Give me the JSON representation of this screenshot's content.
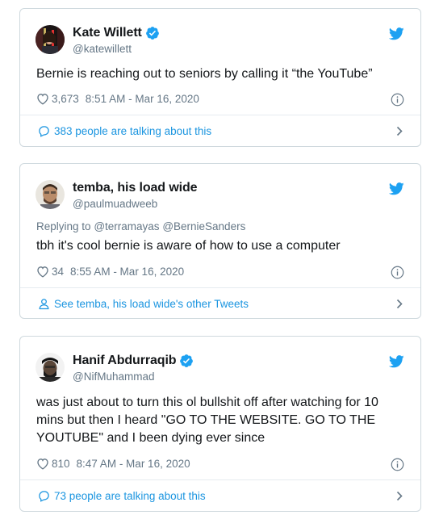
{
  "tweets": [
    {
      "display_name": "Kate Willett",
      "handle": "@katewillett",
      "verified": true,
      "replying_to": null,
      "text": "Bernie is reaching out to seniors by calling it “the YouTube”",
      "likes": "3,673",
      "timestamp": "8:51 AM - Mar 16, 2020",
      "footer_text": "383 people are talking about this",
      "footer_icon": "comment-icon"
    },
    {
      "display_name": "temba, his load wide",
      "handle": "@paulmuadweeb",
      "verified": false,
      "replying_prefix": "Replying to",
      "replying_to_1": "@terramayas",
      "replying_to_2": "@BernieSanders",
      "text": "tbh it's cool bernie is aware of how to use a computer",
      "likes": "34",
      "timestamp": "8:55 AM - Mar 16, 2020",
      "footer_text": "See temba, his load wide's other Tweets",
      "footer_icon": "person-icon"
    },
    {
      "display_name": "Hanif Abdurraqib",
      "handle": "@NifMuhammad",
      "verified": true,
      "replying_to": null,
      "text_line_1": "was just about to turn this ol bullshit off after watching for 10",
      "text_line_2": "mins but then I heard \"GO TO THE WEBSITE. GO TO THE",
      "text_line_3": "YOUTUBE\" and I been dying ever since",
      "likes": "810",
      "timestamp": "8:47 AM - Mar 16, 2020",
      "footer_text": "73 people are talking about this",
      "footer_icon": "comment-icon"
    }
  ],
  "colors": {
    "link_blue": "#1b95e0",
    "twitter_blue": "#1da1f2",
    "muted": "#657786",
    "border": "#cfd9de"
  }
}
